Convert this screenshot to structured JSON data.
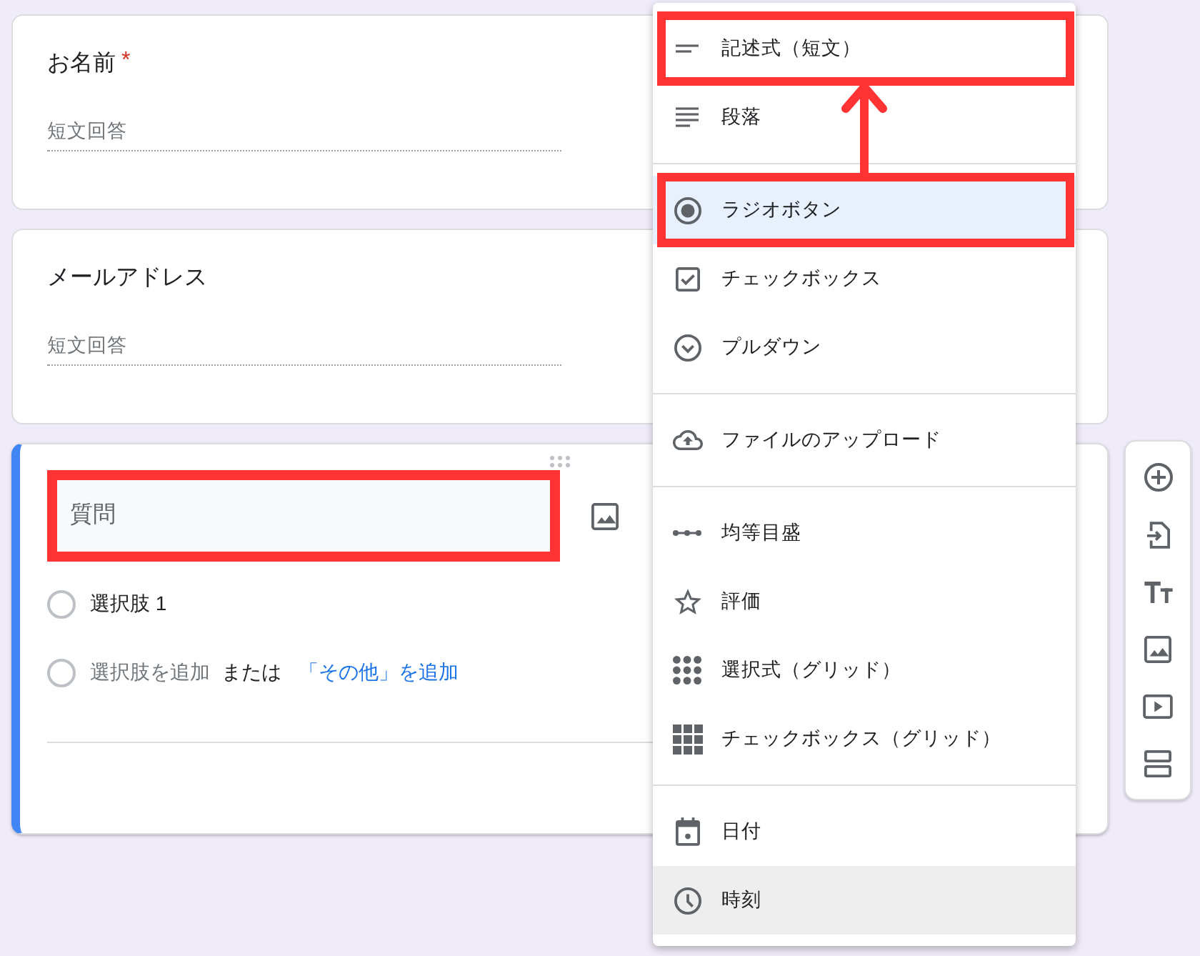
{
  "questions": [
    {
      "kind": "short_answer",
      "active": false,
      "title": "お名前",
      "required_mark": "*",
      "answer": {
        "placeholder": "短文回答"
      }
    },
    {
      "kind": "short_answer",
      "active": false,
      "title": "メールアドレス",
      "answer": {
        "placeholder": "短文回答"
      }
    },
    {
      "kind": "multiple_choice",
      "active": true,
      "title_field": {
        "placeholder": "質問",
        "highlighted": true
      },
      "options": [
        {
          "label": "選択肢 1"
        }
      ],
      "add_option": {
        "label": "選択肢を追加",
        "separator": "または",
        "other_link": "「その他」を追加"
      }
    }
  ],
  "menu": {
    "annotation_arrow": true,
    "groups": [
      {
        "items": [
          {
            "kind": "short_answer",
            "label": "記述式（短文）",
            "selected": false,
            "hovered": false,
            "highlighted": true
          },
          {
            "kind": "paragraph",
            "label": "段落",
            "selected": false,
            "hovered": false,
            "highlighted": false
          }
        ]
      },
      {
        "items": [
          {
            "kind": "multiple_choice",
            "label": "ラジオボタン",
            "selected": true,
            "hovered": false,
            "highlighted": true
          },
          {
            "kind": "checkboxes",
            "label": "チェックボックス",
            "selected": false,
            "hovered": false,
            "highlighted": false
          },
          {
            "kind": "dropdown",
            "label": "プルダウン",
            "selected": false,
            "hovered": false,
            "highlighted": false
          }
        ]
      },
      {
        "items": [
          {
            "kind": "file_upload",
            "label": "ファイルのアップロード",
            "selected": false,
            "hovered": false,
            "highlighted": false
          }
        ]
      },
      {
        "items": [
          {
            "kind": "linear_scale",
            "label": "均等目盛",
            "selected": false,
            "hovered": false,
            "highlighted": false
          },
          {
            "kind": "rating",
            "label": "評価",
            "selected": false,
            "hovered": false,
            "highlighted": false
          },
          {
            "kind": "grid_choice",
            "label": "選択式（グリッド）",
            "selected": false,
            "hovered": false,
            "highlighted": false
          },
          {
            "kind": "grid_checkbox",
            "label": "チェックボックス（グリッド）",
            "selected": false,
            "hovered": false,
            "highlighted": false
          }
        ]
      },
      {
        "items": [
          {
            "kind": "date",
            "label": "日付",
            "selected": false,
            "hovered": false,
            "highlighted": false
          },
          {
            "kind": "time",
            "label": "時刻",
            "selected": false,
            "hovered": true,
            "highlighted": false
          }
        ]
      }
    ]
  },
  "toolbar": {
    "buttons": [
      {
        "kind": "add_question"
      },
      {
        "kind": "import_questions"
      },
      {
        "kind": "add_title"
      },
      {
        "kind": "add_image"
      },
      {
        "kind": "add_video"
      },
      {
        "kind": "add_section"
      }
    ]
  }
}
